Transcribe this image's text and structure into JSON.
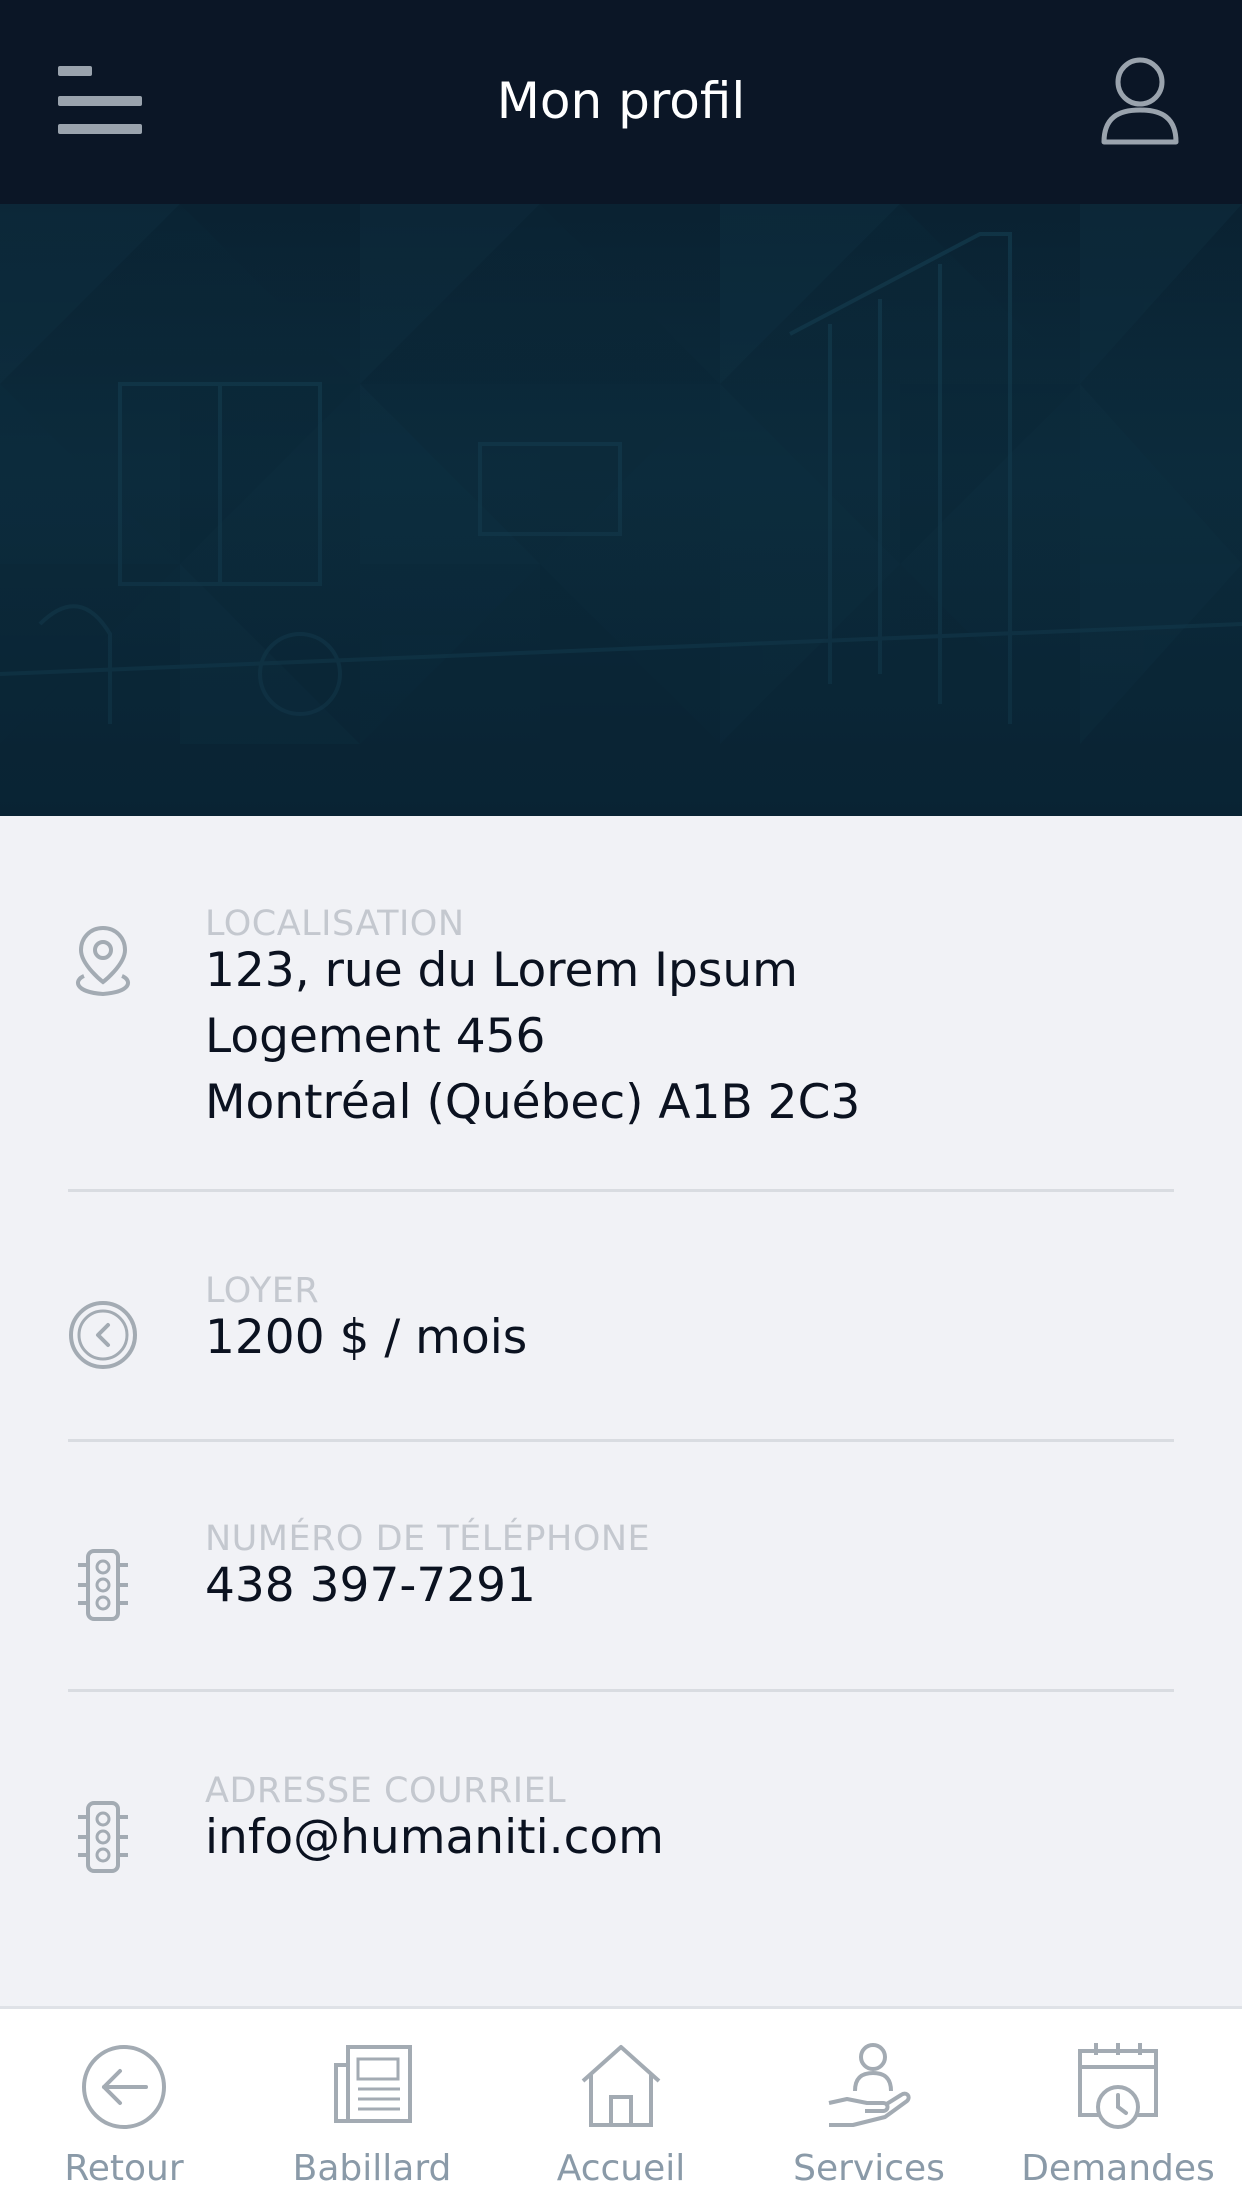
{
  "header": {
    "title": "Mon profil",
    "menu_icon": "hamburger-menu-icon",
    "profile_icon": "user-profile-icon"
  },
  "banner": {
    "description_icon": "apartment-interior-banner"
  },
  "info": {
    "location": {
      "label": "LOCALISATION",
      "line1": "123, rue du Lorem Ipsum",
      "line2": "Logement 456",
      "line3": "Montréal (Québec)  A1B 2C3",
      "icon": "map-pin-icon"
    },
    "rent": {
      "label": "LOYER",
      "value": "1200 $ / mois",
      "icon": "coin-icon"
    },
    "phone": {
      "label": "NUMÉRO DE TÉLÉPHONE",
      "value": "438 397-7291",
      "icon": "phone-device-icon"
    },
    "email": {
      "label": "ADRESSE COURRIEL",
      "value": "info@humaniti.com",
      "icon": "email-device-icon"
    }
  },
  "nav": {
    "items": [
      {
        "label": "Retour",
        "icon": "back-arrow-icon"
      },
      {
        "label": "Babillard",
        "icon": "newspaper-icon"
      },
      {
        "label": "Accueil",
        "icon": "home-icon"
      },
      {
        "label": "Services",
        "icon": "service-hand-icon"
      },
      {
        "label": "Demandes",
        "icon": "calendar-clock-icon"
      }
    ]
  },
  "colors": {
    "header_bg": "#0b1626",
    "banner_bg": "#0d3142",
    "page_bg": "#f1f2f6",
    "label_text": "#c4c8cf",
    "value_text": "#0b1220",
    "nav_text": "#8a9aa8",
    "icon_gray": "#a3abb3"
  }
}
